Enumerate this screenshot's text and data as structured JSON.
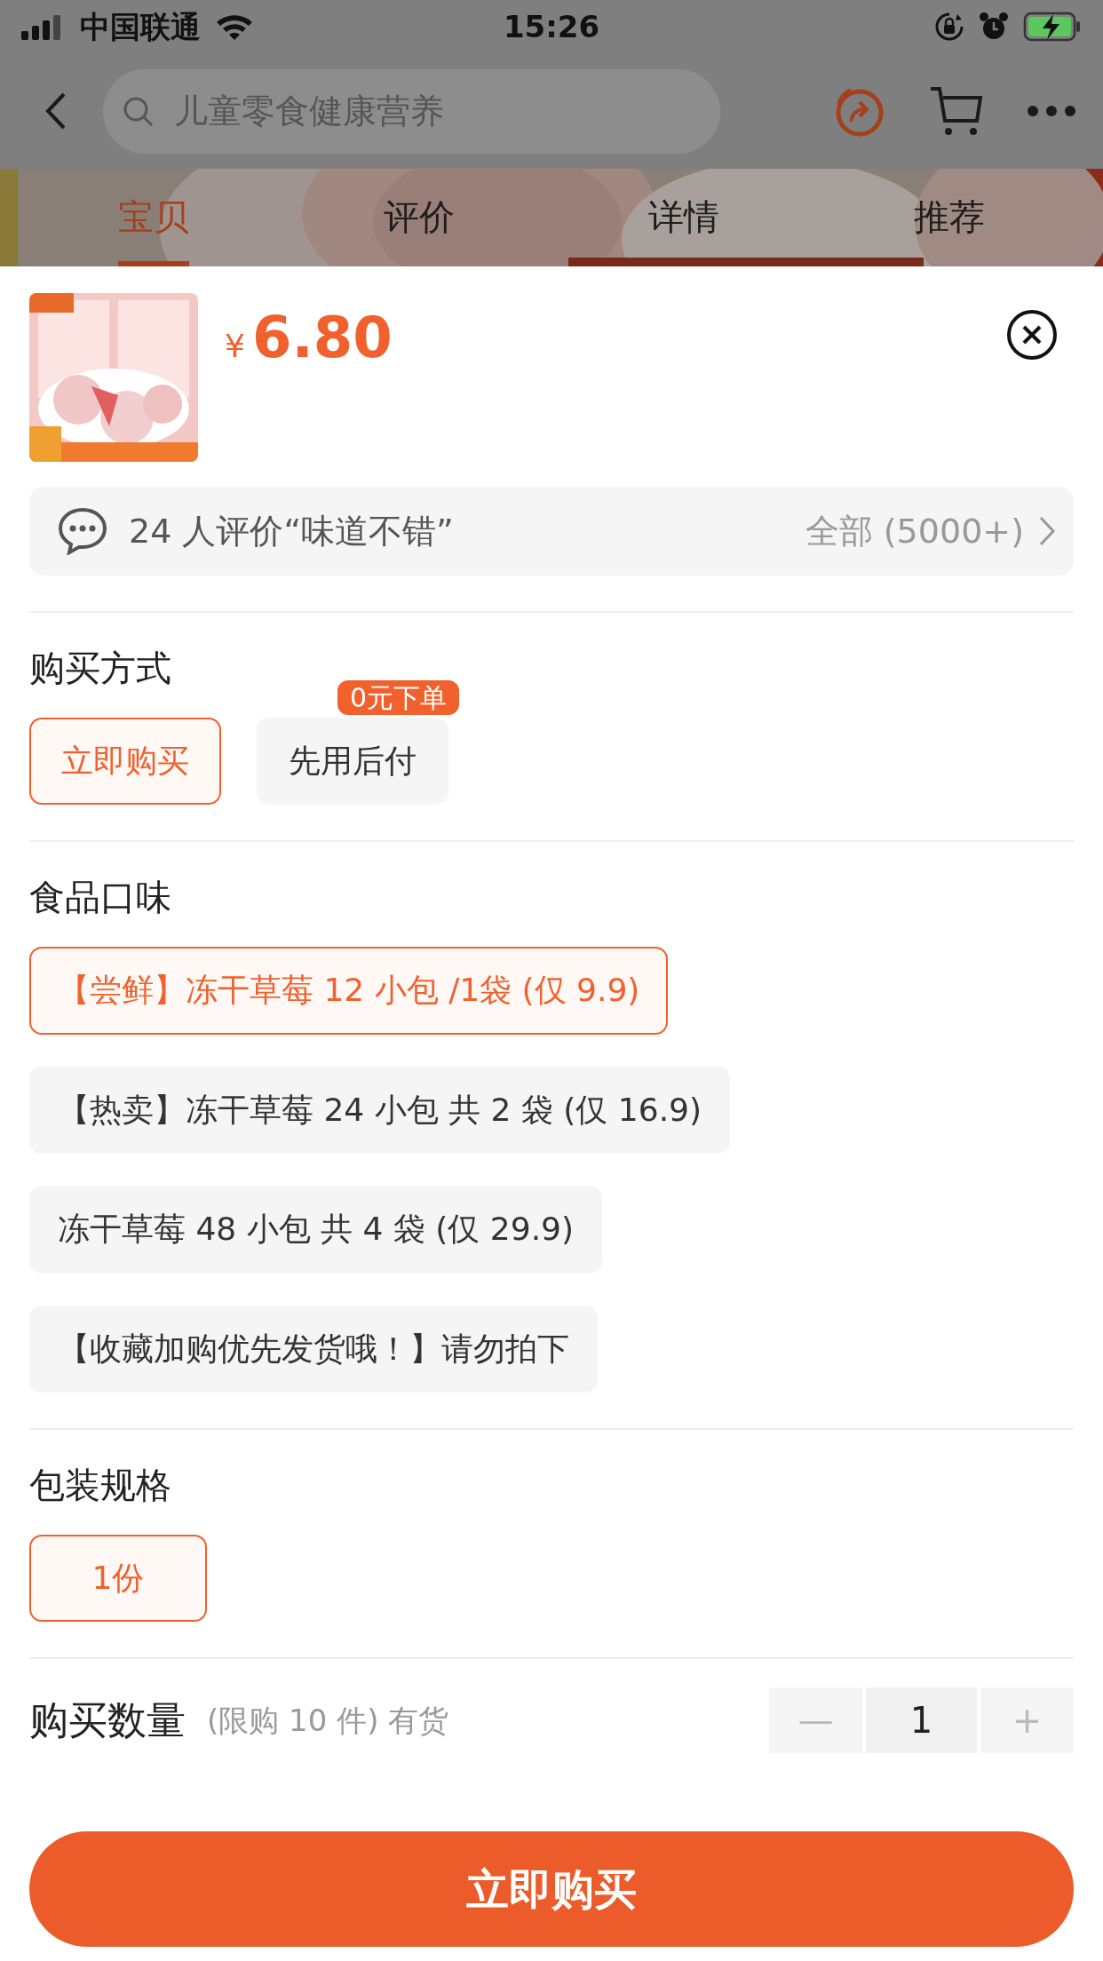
{
  "status_bar": {
    "carrier": "中国联通",
    "time": "15:26"
  },
  "nav": {
    "search_placeholder": "儿童零食健康营养"
  },
  "tabs": [
    {
      "label": "宝贝",
      "selected": true
    },
    {
      "label": "评价",
      "selected": false
    },
    {
      "label": "详情",
      "selected": false
    },
    {
      "label": "推荐",
      "selected": false
    }
  ],
  "product": {
    "currency": "¥",
    "price": "6.80"
  },
  "review_bar": {
    "text": "24 人评价“味道不错”",
    "all": "全部 (5000+)"
  },
  "sections": [
    {
      "title": "购买方式",
      "options": [
        {
          "label": "立即购买",
          "selected": true
        },
        {
          "label": "先用后付",
          "selected": false,
          "badge": "0元下单"
        }
      ]
    },
    {
      "title": "食品口味",
      "options": [
        {
          "label": "【尝鲜】冻干草莓 12 小包 /1袋 (仅 9.9)",
          "selected": true
        },
        {
          "label": "【热卖】冻干草莓 24 小包 共 2 袋 (仅 16.9)",
          "selected": false
        },
        {
          "label": "冻干草莓 48 小包 共 4 袋 (仅 29.9)",
          "selected": false
        },
        {
          "label": "【收藏加购优先发货哦！】请勿拍下",
          "selected": false
        }
      ]
    },
    {
      "title": "包装规格",
      "options": [
        {
          "label": "1份",
          "selected": true
        }
      ]
    }
  ],
  "quantity": {
    "title": "购买数量",
    "note": "(限购 10 件) 有货",
    "minus": "—",
    "value": "1",
    "plus": "+"
  },
  "buy_button": "立即购买"
}
